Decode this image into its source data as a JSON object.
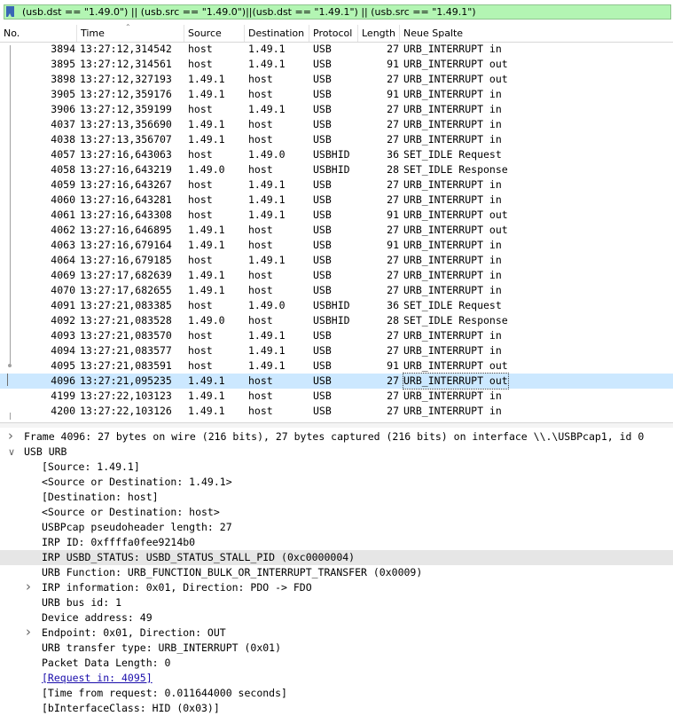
{
  "filter": {
    "text": "(usb.dst == \"1.49.0\") || (usb.src == \"1.49.0\")||(usb.dst == \"1.49.1\") || (usb.src == \"1.49.1\")"
  },
  "columns": {
    "no": "No.",
    "time": "Time",
    "source": "Source",
    "destination": "Destination",
    "protocol": "Protocol",
    "length": "Length",
    "info": "Neue Spalte"
  },
  "packets": [
    {
      "no": "3894",
      "time": "13:27:12,314542",
      "src": "host",
      "dst": "1.49.1",
      "proto": "USB",
      "len": "27",
      "info": "URB_INTERRUPT in"
    },
    {
      "no": "3895",
      "time": "13:27:12,314561",
      "src": "host",
      "dst": "1.49.1",
      "proto": "USB",
      "len": "91",
      "info": "URB_INTERRUPT out"
    },
    {
      "no": "3898",
      "time": "13:27:12,327193",
      "src": "1.49.1",
      "dst": "host",
      "proto": "USB",
      "len": "27",
      "info": "URB_INTERRUPT out"
    },
    {
      "no": "3905",
      "time": "13:27:12,359176",
      "src": "1.49.1",
      "dst": "host",
      "proto": "USB",
      "len": "91",
      "info": "URB_INTERRUPT in"
    },
    {
      "no": "3906",
      "time": "13:27:12,359199",
      "src": "host",
      "dst": "1.49.1",
      "proto": "USB",
      "len": "27",
      "info": "URB_INTERRUPT in"
    },
    {
      "no": "4037",
      "time": "13:27:13,356690",
      "src": "1.49.1",
      "dst": "host",
      "proto": "USB",
      "len": "27",
      "info": "URB_INTERRUPT in"
    },
    {
      "no": "4038",
      "time": "13:27:13,356707",
      "src": "1.49.1",
      "dst": "host",
      "proto": "USB",
      "len": "27",
      "info": "URB_INTERRUPT in"
    },
    {
      "no": "4057",
      "time": "13:27:16,643063",
      "src": "host",
      "dst": "1.49.0",
      "proto": "USBHID",
      "len": "36",
      "info": "SET_IDLE Request"
    },
    {
      "no": "4058",
      "time": "13:27:16,643219",
      "src": "1.49.0",
      "dst": "host",
      "proto": "USBHID",
      "len": "28",
      "info": "SET_IDLE Response"
    },
    {
      "no": "4059",
      "time": "13:27:16,643267",
      "src": "host",
      "dst": "1.49.1",
      "proto": "USB",
      "len": "27",
      "info": "URB_INTERRUPT in"
    },
    {
      "no": "4060",
      "time": "13:27:16,643281",
      "src": "host",
      "dst": "1.49.1",
      "proto": "USB",
      "len": "27",
      "info": "URB_INTERRUPT in"
    },
    {
      "no": "4061",
      "time": "13:27:16,643308",
      "src": "host",
      "dst": "1.49.1",
      "proto": "USB",
      "len": "91",
      "info": "URB_INTERRUPT out"
    },
    {
      "no": "4062",
      "time": "13:27:16,646895",
      "src": "1.49.1",
      "dst": "host",
      "proto": "USB",
      "len": "27",
      "info": "URB_INTERRUPT out"
    },
    {
      "no": "4063",
      "time": "13:27:16,679164",
      "src": "1.49.1",
      "dst": "host",
      "proto": "USB",
      "len": "91",
      "info": "URB_INTERRUPT in"
    },
    {
      "no": "4064",
      "time": "13:27:16,679185",
      "src": "host",
      "dst": "1.49.1",
      "proto": "USB",
      "len": "27",
      "info": "URB_INTERRUPT in"
    },
    {
      "no": "4069",
      "time": "13:27:17,682639",
      "src": "1.49.1",
      "dst": "host",
      "proto": "USB",
      "len": "27",
      "info": "URB_INTERRUPT in"
    },
    {
      "no": "4070",
      "time": "13:27:17,682655",
      "src": "1.49.1",
      "dst": "host",
      "proto": "USB",
      "len": "27",
      "info": "URB_INTERRUPT in"
    },
    {
      "no": "4091",
      "time": "13:27:21,083385",
      "src": "host",
      "dst": "1.49.0",
      "proto": "USBHID",
      "len": "36",
      "info": "SET_IDLE Request"
    },
    {
      "no": "4092",
      "time": "13:27:21,083528",
      "src": "1.49.0",
      "dst": "host",
      "proto": "USBHID",
      "len": "28",
      "info": "SET_IDLE Response"
    },
    {
      "no": "4093",
      "time": "13:27:21,083570",
      "src": "host",
      "dst": "1.49.1",
      "proto": "USB",
      "len": "27",
      "info": "URB_INTERRUPT in"
    },
    {
      "no": "4094",
      "time": "13:27:21,083577",
      "src": "host",
      "dst": "1.49.1",
      "proto": "USB",
      "len": "27",
      "info": "URB_INTERRUPT in"
    },
    {
      "no": "4095",
      "time": "13:27:21,083591",
      "src": "host",
      "dst": "1.49.1",
      "proto": "USB",
      "len": "91",
      "info": "URB_INTERRUPT out"
    },
    {
      "no": "4096",
      "time": "13:27:21,095235",
      "src": "1.49.1",
      "dst": "host",
      "proto": "USB",
      "len": "27",
      "info": "URB_INTERRUPT out",
      "selected": true
    },
    {
      "no": "4199",
      "time": "13:27:22,103123",
      "src": "1.49.1",
      "dst": "host",
      "proto": "USB",
      "len": "27",
      "info": "URB_INTERRUPT in"
    },
    {
      "no": "4200",
      "time": "13:27:22,103126",
      "src": "1.49.1",
      "dst": "host",
      "proto": "USB",
      "len": "27",
      "info": "URB_INTERRUPT in"
    }
  ],
  "details": [
    {
      "text": "Frame 4096: 27 bytes on wire (216 bits), 27 bytes captured (216 bits) on interface \\\\.\\USBPcap1, id 0",
      "level": 0,
      "toggle": "collapsed"
    },
    {
      "text": "USB URB",
      "level": 0,
      "toggle": "expanded"
    },
    {
      "text": "[Source: 1.49.1]",
      "level": 1
    },
    {
      "text": "<Source or Destination: 1.49.1>",
      "level": 1
    },
    {
      "text": "[Destination: host]",
      "level": 1
    },
    {
      "text": "<Source or Destination: host>",
      "level": 1
    },
    {
      "text": "USBPcap pseudoheader length: 27",
      "level": 1
    },
    {
      "text": "IRP ID: 0xffffa0fee9214b0",
      "level": 1
    },
    {
      "text": "IRP USBD_STATUS: USBD_STATUS_STALL_PID (0xc0000004)",
      "level": 1,
      "highlight": true
    },
    {
      "text": "URB Function: URB_FUNCTION_BULK_OR_INTERRUPT_TRANSFER (0x0009)",
      "level": 1
    },
    {
      "text": "IRP information: 0x01, Direction: PDO -> FDO",
      "level": 1,
      "toggle": "collapsed"
    },
    {
      "text": "URB bus id: 1",
      "level": 1
    },
    {
      "text": "Device address: 49",
      "level": 1
    },
    {
      "text": "Endpoint: 0x01, Direction: OUT",
      "level": 1,
      "toggle": "collapsed"
    },
    {
      "text": "URB transfer type: URB_INTERRUPT (0x01)",
      "level": 1
    },
    {
      "text": "Packet Data Length: 0",
      "level": 1
    },
    {
      "text": "[Request in: 4095]",
      "level": 1,
      "link": true
    },
    {
      "text": "[Time from request: 0.011644000 seconds]",
      "level": 1
    },
    {
      "text": "[bInterfaceClass: HID (0x03)]",
      "level": 1
    }
  ],
  "icons": {
    "bookmark": "bookmark-icon",
    "sort": "sort-ascending-icon",
    "expanded": "chevron-down-icon",
    "collapsed": "chevron-right-icon"
  },
  "colors": {
    "filter_valid": "#b3f5b3",
    "selected_row": "#cce8ff",
    "highlight_row": "#e6e6e6",
    "link": "#1a0dab"
  }
}
